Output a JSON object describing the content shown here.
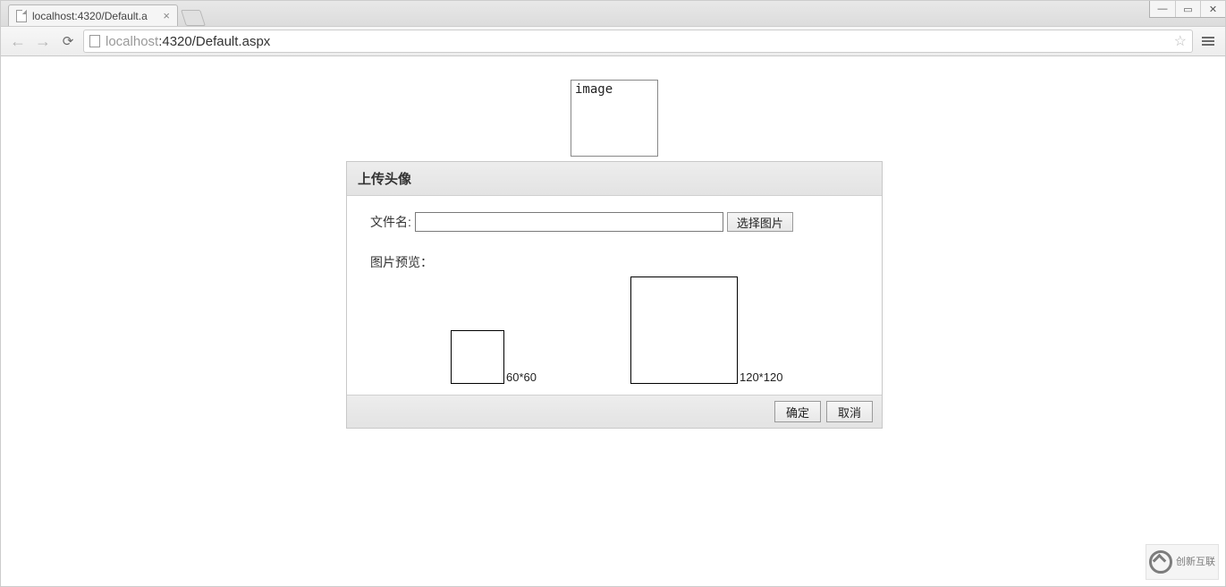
{
  "window": {
    "minimize": "—",
    "maximize": "▭",
    "close": "✕"
  },
  "tab": {
    "title": "localhost:4320/Default.a",
    "close": "×"
  },
  "address": {
    "host_dim": "localhost",
    "rest": ":4320/Default.aspx"
  },
  "page": {
    "image_alt": "image",
    "dialog": {
      "title": "上传头像",
      "file_label": "文件名:",
      "file_value": "",
      "choose_button": "选择图片",
      "preview_label": "图片预览：",
      "size_small": "60*60",
      "size_large": "120*120",
      "ok": "确定",
      "cancel": "取消"
    }
  },
  "watermark": {
    "brand": "创新互联"
  }
}
